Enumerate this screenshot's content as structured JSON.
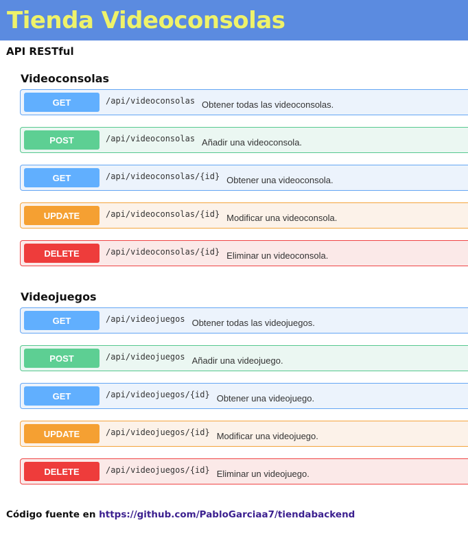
{
  "header": {
    "title": "Tienda Videoconsolas"
  },
  "subtitle": "API RESTful",
  "sections": [
    {
      "title": "Videoconsolas",
      "ops": [
        {
          "method": "GET",
          "path": "/api/videoconsolas",
          "desc": "Obtener todas las videoconsolas."
        },
        {
          "method": "POST",
          "path": "/api/videoconsolas",
          "desc": "Añadir una videoconsola."
        },
        {
          "method": "GET",
          "path": "/api/videoconsolas/{id}",
          "desc": "Obtener una videoconsola."
        },
        {
          "method": "UPDATE",
          "path": "/api/videoconsolas/{id}",
          "desc": "Modificar una videoconsola."
        },
        {
          "method": "DELETE",
          "path": "/api/videoconsolas/{id}",
          "desc": "Eliminar un videoconsola."
        }
      ]
    },
    {
      "title": "Videojuegos",
      "ops": [
        {
          "method": "GET",
          "path": "/api/videojuegos",
          "desc": "Obtener todas las videojuegos."
        },
        {
          "method": "POST",
          "path": "/api/videojuegos",
          "desc": "Añadir una videojuego."
        },
        {
          "method": "GET",
          "path": "/api/videojuegos/{id}",
          "desc": "Obtener una videojuego."
        },
        {
          "method": "UPDATE",
          "path": "/api/videojuegos/{id}",
          "desc": "Modificar una videojuego."
        },
        {
          "method": "DELETE",
          "path": "/api/videojuegos/{id}",
          "desc": "Eliminar un videojuego."
        }
      ]
    }
  ],
  "footer": {
    "text": "Código fuente en",
    "link": "https://github.com/PabloGarciaa7/tiendabackend"
  },
  "colors": {
    "header_bg": "#5b8be0",
    "title": "#eef26a",
    "get": "#61affe",
    "post": "#5dcf93",
    "update": "#f5a032",
    "delete": "#ee3c3b"
  }
}
